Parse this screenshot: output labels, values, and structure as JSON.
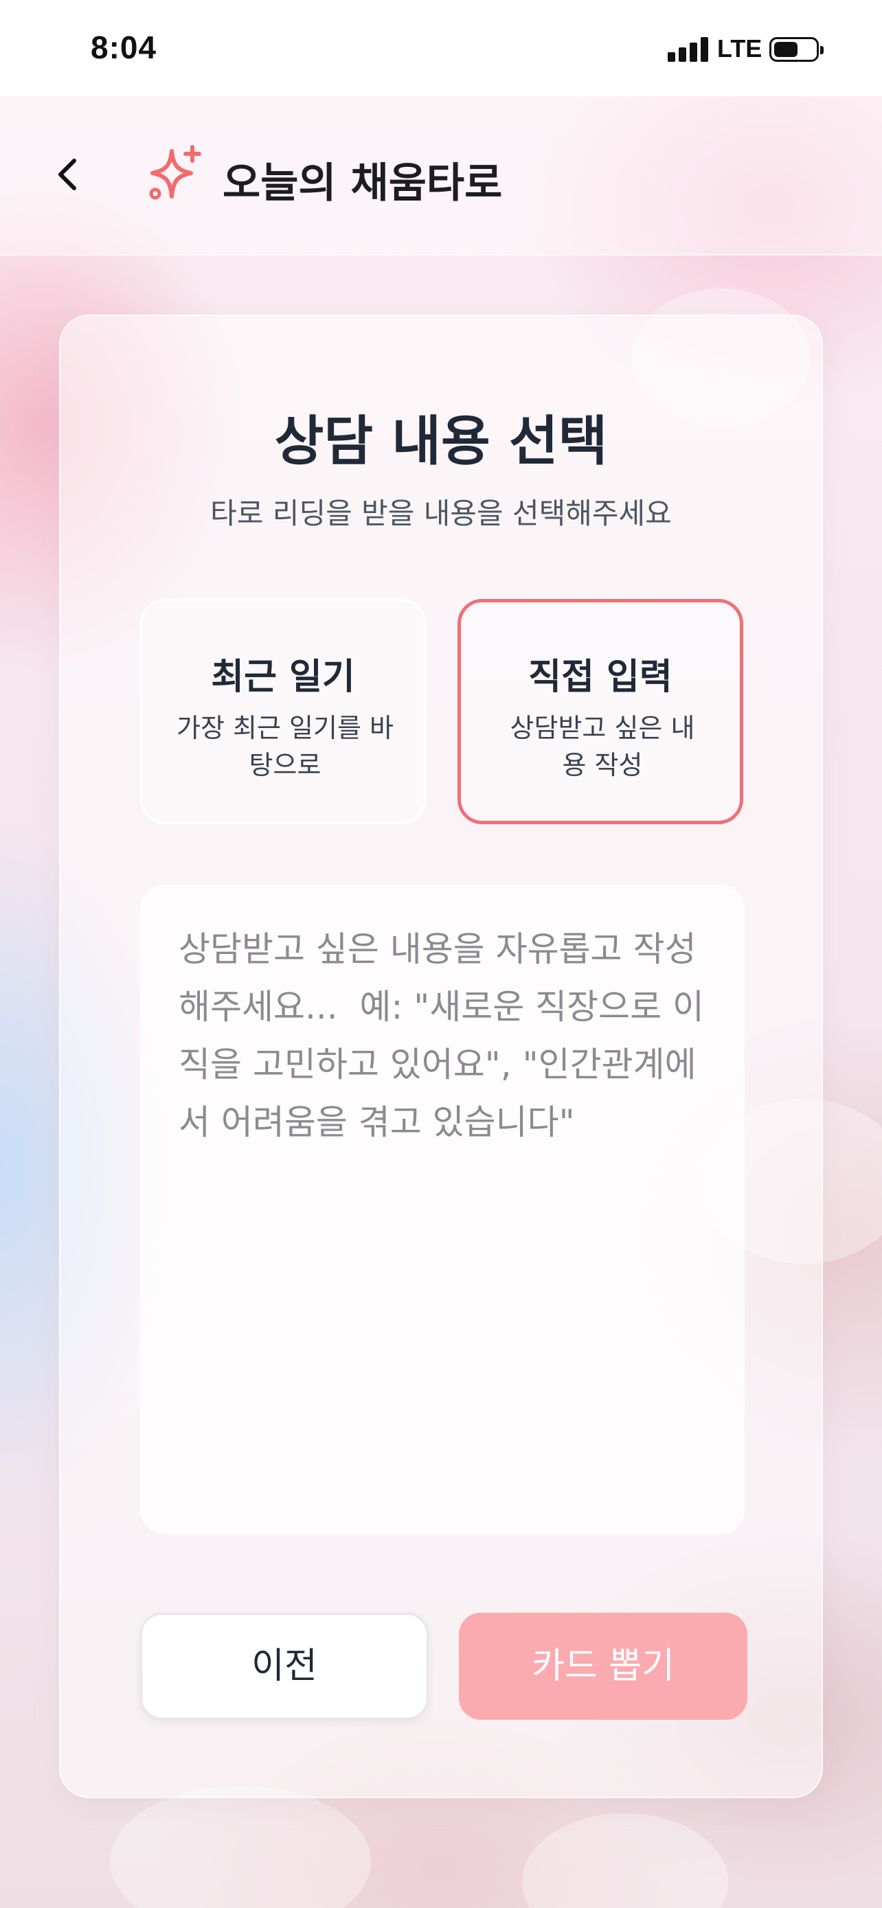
{
  "status_bar": {
    "time": "8:04",
    "network": "LTE"
  },
  "header": {
    "title": "오늘의 채움타로",
    "back_icon": "chevron-left-icon",
    "logo_icon": "sparkles-icon"
  },
  "main": {
    "title": "상담 내용 선택",
    "subtitle": "타로 리딩을 받을 내용을 선택해주세요",
    "options": [
      {
        "title": "최근 일기",
        "description": "가장 최근 일기를 바탕으로",
        "selected": false
      },
      {
        "title": "직접 입력",
        "description": "상담받고 싶은 내용 작성",
        "selected": true
      }
    ],
    "input": {
      "value": "",
      "placeholder": "상담받고 싶은 내용을 자유롭고 작성해주세요...  예: \"새로운 직장으로 이직을 고민하고 있어요\", \"인간관계에서 어려움을 겪고 있습니다\""
    },
    "buttons": {
      "prev": "이전",
      "draw": "카드 뽑기"
    }
  },
  "colors": {
    "accent": "#f07077",
    "primary_button_disabled": "#fbaaaf",
    "text_dark": "#1f2937"
  }
}
